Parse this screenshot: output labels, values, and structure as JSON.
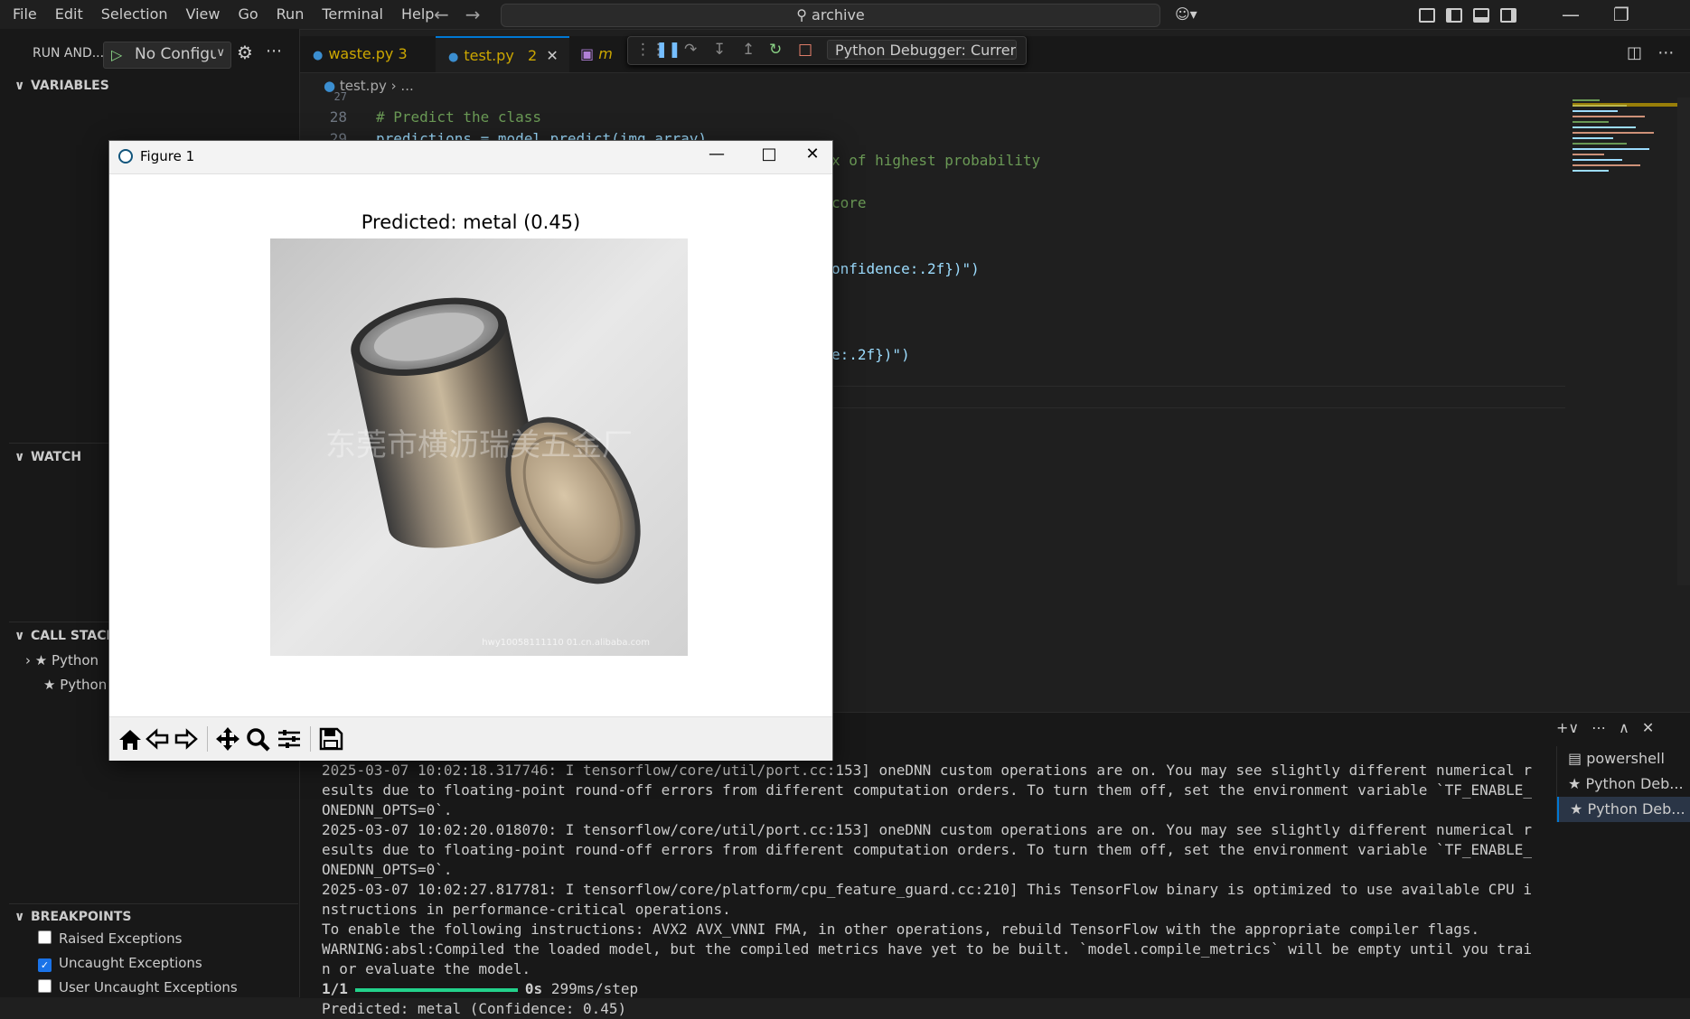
{
  "menu": {
    "items": [
      "File",
      "Edit",
      "Selection",
      "View",
      "Go",
      "Run",
      "Terminal",
      "Help"
    ]
  },
  "search": {
    "text": "archive"
  },
  "sidebar": {
    "run_title": "RUN AND...",
    "config": "No Configurations",
    "variables": "VARIABLES",
    "watch": "WATCH",
    "call_stack": "CALL STACK",
    "stack_items": [
      "Python",
      "Python"
    ],
    "breakpoints": "BREAKPOINTS",
    "bp_items": [
      {
        "label": "Raised Exceptions",
        "checked": false
      },
      {
        "label": "Uncaught Exceptions",
        "checked": true
      },
      {
        "label": "User Uncaught Exceptions",
        "checked": false
      }
    ]
  },
  "tabs": [
    {
      "name": "waste.py",
      "badge": "3"
    },
    {
      "name": "test.py",
      "badge": "2"
    },
    {
      "name": "m"
    }
  ],
  "debugger": {
    "config": "Python Debugger: Current File"
  },
  "breadcrumb": {
    "file": "test.py",
    "rest": "..."
  },
  "code": {
    "line_numbers": [
      "27",
      "28",
      "29"
    ],
    "comment_line": "# Predict the class",
    "predict_line": "predictions = model.predict(img_array)",
    "frag_highest": "x of highest probability",
    "frag_score": "core",
    "frag_conf": "onfidence:.2f})\")",
    "frag_e": "e:.2f})\")"
  },
  "figure": {
    "window_title": "Figure 1",
    "plot_title": "Predicted: metal (0.45)",
    "watermark": "东莞市横沥瑞美五金厂",
    "image_footer": "hwy10058111110 01.cn.alibaba.com"
  },
  "terminal": {
    "lines": [
      "2025-03-07 10:02:18.317746: I tensorflow/core/util/port.cc:153] oneDNN custom operations are on. You may see slightly different numerical results due to floating-point round-off errors from different computation orders. To turn them off, set the environment variable `TF_ENABLE_ONEDNN_OPTS=0`.",
      "2025-03-07 10:02:20.018070: I tensorflow/core/util/port.cc:153] oneDNN custom operations are on. You may see slightly different numerical results due to floating-point round-off errors from different computation orders. To turn them off, set the environment variable `TF_ENABLE_ONEDNN_OPTS=0`.",
      "2025-03-07 10:02:27.817781: I tensorflow/core/platform/cpu_feature_guard.cc:210] This TensorFlow binary is optimized to use available CPU instructions in performance-critical operations.",
      "To enable the following instructions: AVX2 AVX_VNNI FMA, in other operations, rebuild TensorFlow with the appropriate compiler flags.",
      "WARNING:absl:Compiled the loaded model, but the compiled metrics have yet to be built. `model.compile_metrics` will be empty until you train or evaluate the model."
    ],
    "progress_count": "1/1",
    "progress_time": "0s",
    "progress_rate": "299ms/step",
    "result": "Predicted: metal (Confidence: 0.45)",
    "sessions": [
      "powershell",
      "Python Deb...",
      "Python Deb..."
    ]
  }
}
